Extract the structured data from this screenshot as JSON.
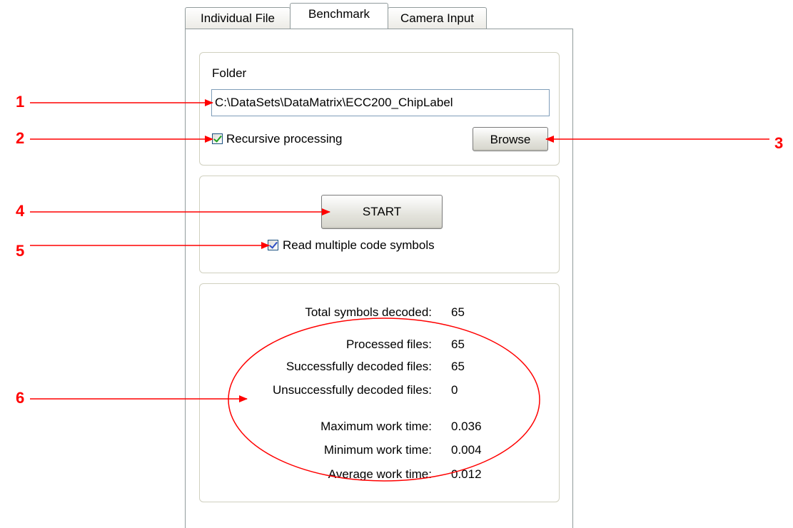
{
  "tabs": [
    {
      "label": "Individual File",
      "active": false
    },
    {
      "label": "Benchmark",
      "active": true
    },
    {
      "label": "Camera Input",
      "active": false
    }
  ],
  "folder": {
    "label": "Folder",
    "path": "C:\\DataSets\\DataMatrix\\ECC200_ChipLabel",
    "recursive_label": "Recursive processing",
    "recursive_checked": true,
    "browse_label": "Browse"
  },
  "run": {
    "start_label": "START",
    "multiple_label": "Read multiple code symbols",
    "multiple_checked": true
  },
  "stats": [
    {
      "label": "Total symbols decoded:",
      "value": "65"
    },
    {
      "label": "Processed files:",
      "value": "65"
    },
    {
      "label": "Successfully decoded files:",
      "value": "65"
    },
    {
      "label": "Unsuccessfully decoded files:",
      "value": "0"
    },
    {
      "label": "Maximum work time:",
      "value": "0.036"
    },
    {
      "label": "Minimum work time:",
      "value": "0.004"
    },
    {
      "label": "Average work time:",
      "value": "0.012"
    }
  ],
  "callouts": [
    "1",
    "2",
    "3",
    "4",
    "5",
    "6"
  ],
  "colors": {
    "annotation": "#ff0000",
    "tab_border": "#919b9c",
    "group_border": "#d0d0bf"
  }
}
